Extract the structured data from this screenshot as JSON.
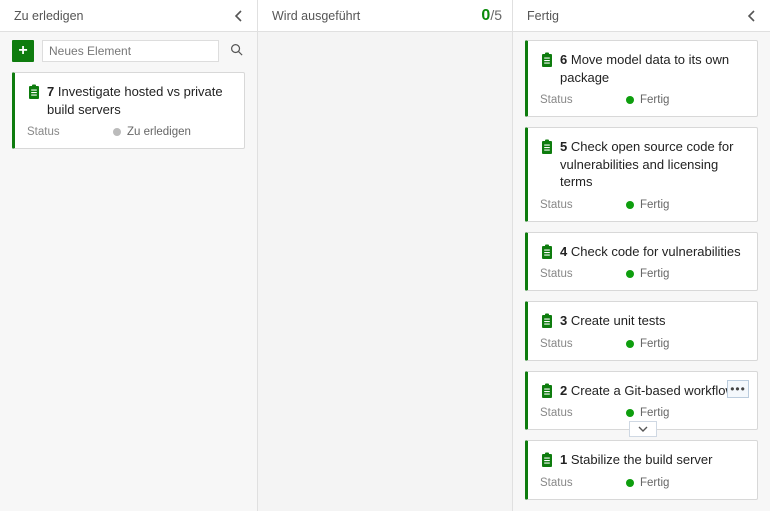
{
  "columns": {
    "todo": {
      "title": "Zu erledigen"
    },
    "doing": {
      "title": "Wird ausgeführt",
      "wip_current": "0",
      "wip_max": "5"
    },
    "done": {
      "title": "Fertig"
    }
  },
  "add": {
    "placeholder": "Neues Element"
  },
  "status_label": "Status",
  "status_values": {
    "todo": "Zu erledigen",
    "done": "Fertig"
  },
  "cards": {
    "todo": [
      {
        "num": "7",
        "title": "Investigate hosted vs private build servers"
      }
    ],
    "done": [
      {
        "num": "6",
        "title": "Move model data to its own package"
      },
      {
        "num": "5",
        "title": "Check open source code for vulnerabilities and licensing terms"
      },
      {
        "num": "4",
        "title": "Check code for vulnerabilities"
      },
      {
        "num": "3",
        "title": "Create unit tests"
      },
      {
        "num": "2",
        "title": "Create a Git-based workflow",
        "more": true,
        "expand": true
      },
      {
        "num": "1",
        "title": "Stabilize the build server"
      }
    ]
  }
}
